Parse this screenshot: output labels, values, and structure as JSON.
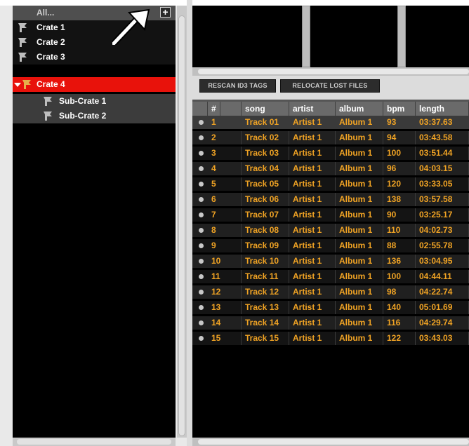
{
  "crates": {
    "all_label": "All...",
    "add_button_label": "+",
    "items": [
      {
        "label": "Crate 1",
        "level": 0,
        "selected": false
      },
      {
        "label": "Crate 2",
        "level": 0,
        "selected": false
      },
      {
        "label": "Crate 3",
        "level": 0,
        "selected": false
      },
      {
        "label": "Crate 4",
        "level": 0,
        "selected": true,
        "expanded": true
      },
      {
        "label": "Sub-Crate 1",
        "level": 1,
        "selected": false
      },
      {
        "label": "Sub-Crate 2",
        "level": 1,
        "selected": false
      }
    ]
  },
  "toolbar": {
    "rescan_label": "RESCAN ID3 TAGS",
    "relocate_label": "RELOCATE LOST FILES"
  },
  "table": {
    "columns": [
      "",
      "#",
      "song",
      "artist",
      "album",
      "bpm",
      "length"
    ],
    "rows": [
      {
        "num": "1",
        "song": "Track 01",
        "artist": "Artist 1",
        "album": "Album 1",
        "bpm": "93",
        "length": "03:37.63",
        "selected": true
      },
      {
        "num": "2",
        "song": "Track 02",
        "artist": "Artist 1",
        "album": "Album 1",
        "bpm": "94",
        "length": "03:43.58"
      },
      {
        "num": "3",
        "song": "Track 03",
        "artist": "Artist 1",
        "album": "Album 1",
        "bpm": "100",
        "length": "03:51.44"
      },
      {
        "num": "4",
        "song": "Track 04",
        "artist": "Artist 1",
        "album": "Album 1",
        "bpm": "96",
        "length": "04:03.15"
      },
      {
        "num": "5",
        "song": "Track 05",
        "artist": "Artist 1",
        "album": "Album 1",
        "bpm": "120",
        "length": "03:33.05"
      },
      {
        "num": "6",
        "song": "Track 06",
        "artist": "Artist 1",
        "album": "Album 1",
        "bpm": "138",
        "length": "03:57.58"
      },
      {
        "num": "7",
        "song": "Track 07",
        "artist": "Artist 1",
        "album": "Album 1",
        "bpm": "90",
        "length": "03:25.17"
      },
      {
        "num": "8",
        "song": "Track 08",
        "artist": "Artist 1",
        "album": "Album 1",
        "bpm": "110",
        "length": "04:02.73"
      },
      {
        "num": "9",
        "song": "Track 09",
        "artist": "Artist 1",
        "album": "Album 1",
        "bpm": "88",
        "length": "02:55.78"
      },
      {
        "num": "10",
        "song": "Track 10",
        "artist": "Artist 1",
        "album": "Album 1",
        "bpm": "136",
        "length": "03:04.95"
      },
      {
        "num": "11",
        "song": "Track 11",
        "artist": "Artist 1",
        "album": "Album 1",
        "bpm": "100",
        "length": "04:44.11"
      },
      {
        "num": "12",
        "song": "Track 12",
        "artist": "Artist 1",
        "album": "Album 1",
        "bpm": "98",
        "length": "04:22.74"
      },
      {
        "num": "13",
        "song": "Track 13",
        "artist": "Artist 1",
        "album": "Album 1",
        "bpm": "140",
        "length": "05:01.69"
      },
      {
        "num": "14",
        "song": "Track 14",
        "artist": "Artist 1",
        "album": "Album 1",
        "bpm": "116",
        "length": "04:29.74"
      },
      {
        "num": "15",
        "song": "Track 15",
        "artist": "Artist 1",
        "album": "Album 1",
        "bpm": "122",
        "length": "03:43.03"
      }
    ]
  },
  "colors": {
    "selected_crate": "#e8120b",
    "track_text": "#f0a324",
    "panel_bg": "#000000"
  }
}
